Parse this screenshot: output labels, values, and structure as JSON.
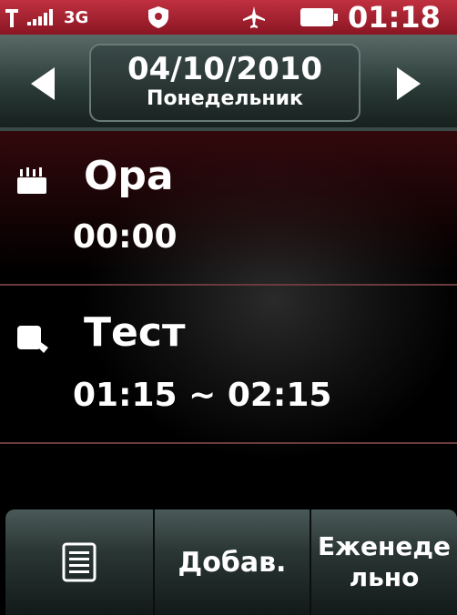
{
  "status_bar": {
    "network_label": "3G",
    "clock": "01:18"
  },
  "date_header": {
    "date": "04/10/2010",
    "weekday": "Понедельник"
  },
  "events": [
    {
      "title": "Ора",
      "time": "00:00",
      "icon": "birthday-cake-icon"
    },
    {
      "title": "Тест",
      "time": "01:15 ~ 02:15",
      "icon": "meeting-icon"
    }
  ],
  "bottom_bar": {
    "list_icon": "list-icon",
    "add_label": "Добав.",
    "weekly_label": "Еженедельно"
  },
  "colors": {
    "status_bar": "#a82233",
    "separator": "#6a3a3e",
    "toolbar": "#2a3634"
  }
}
